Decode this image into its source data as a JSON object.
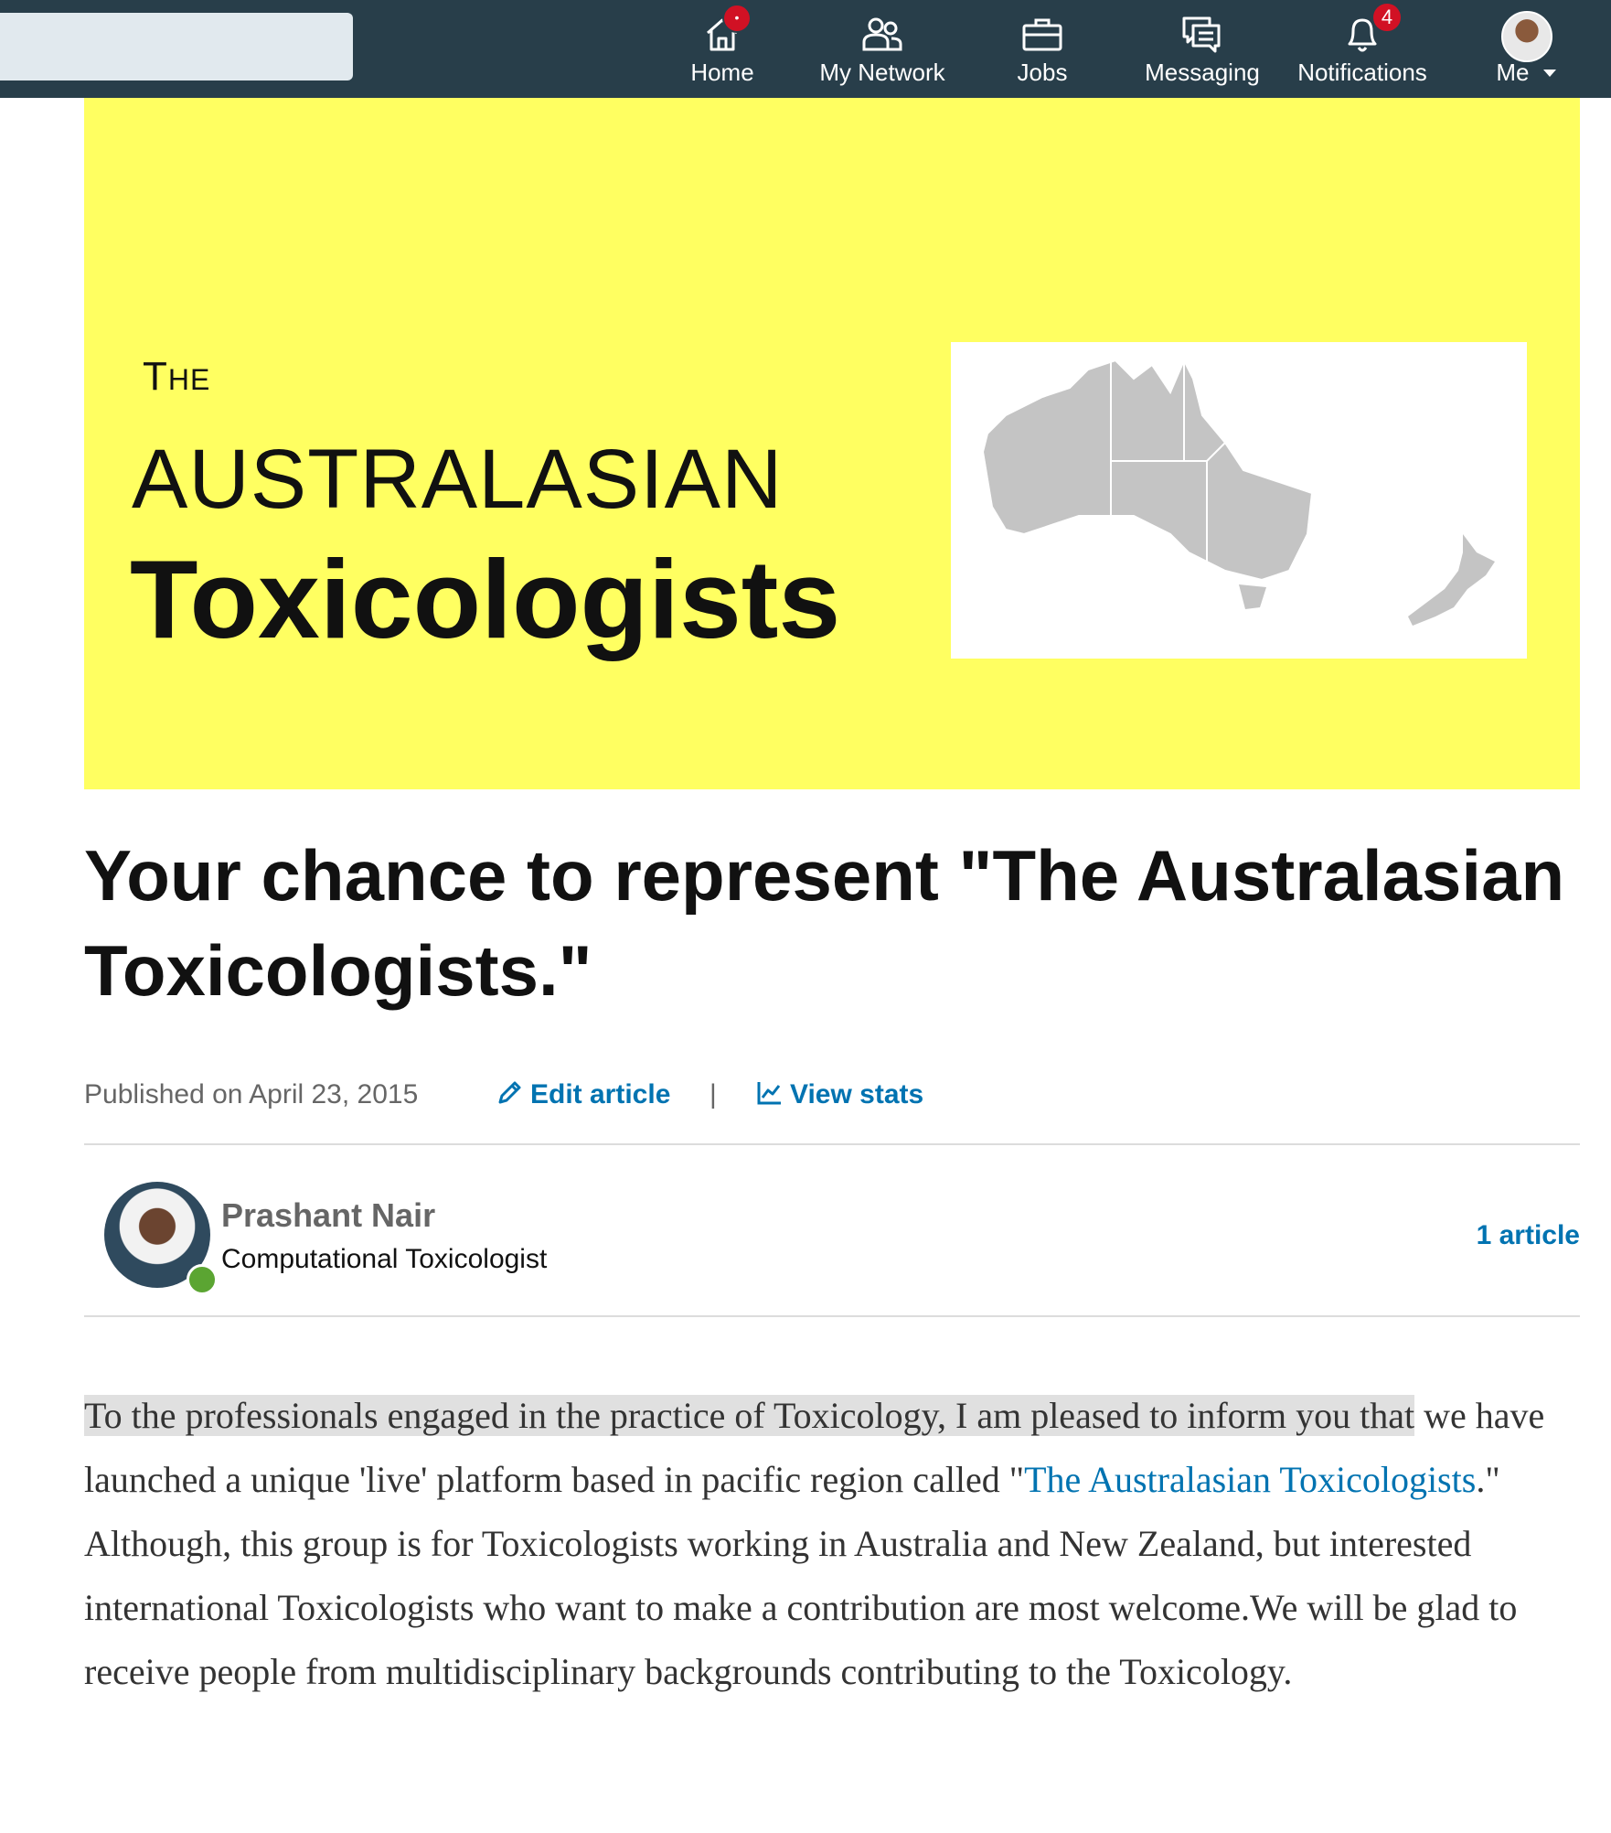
{
  "nav": {
    "items": [
      {
        "label": "Home",
        "icon": "home-icon",
        "badge": "•"
      },
      {
        "label": "My Network",
        "icon": "network-icon"
      },
      {
        "label": "Jobs",
        "icon": "briefcase-icon"
      },
      {
        "label": "Messaging",
        "icon": "messaging-icon"
      },
      {
        "label": "Notifications",
        "icon": "bell-icon",
        "badge": "4"
      },
      {
        "label": "Me",
        "icon": "profile-avatar"
      }
    ],
    "bg_color": "#283e4a"
  },
  "banner": {
    "the": "The",
    "line1": "AUSTRALASIAN",
    "line2": "Toxicologists",
    "bg_color": "#ffff61"
  },
  "article": {
    "title": "Your chance to represent \"The Australasian Toxicologists.\"",
    "published": "Published on April 23, 2015",
    "edit_label": "Edit article",
    "separator": "|",
    "stats_label": "View stats"
  },
  "author": {
    "name": "Prashant Nair",
    "headline": "Computational Toxicologist",
    "articles": "1 article"
  },
  "body": {
    "highlight": "To the professionals engaged in the practice of Toxicology, I am pleased to inform you that",
    "part1": " we have launched a unique 'live' platform based in pacific region called \"",
    "link": "The Australasian Toxicologists",
    "part2": ".\" Although, this group is for Toxicologists working in Australia and New Zealand, but interested international Toxicologists who want to make a contribution are most welcome.We will be glad to receive people from multidisciplinary backgrounds contributing to the Toxicology."
  },
  "colors": {
    "link": "#0073b1",
    "online": "#5ba532",
    "badge": "#d11124"
  }
}
